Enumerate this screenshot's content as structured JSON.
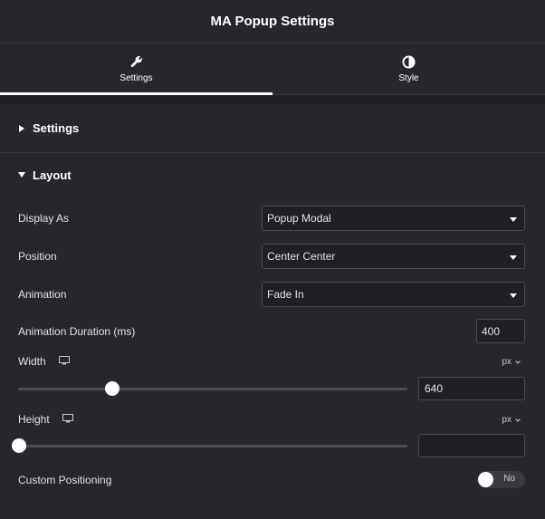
{
  "header": {
    "title": "MA Popup Settings"
  },
  "tabs": [
    {
      "label": "Settings",
      "icon": "wrench-icon",
      "active": true
    },
    {
      "label": "Style",
      "icon": "half-circle-icon",
      "active": false
    }
  ],
  "sections": {
    "settings": {
      "label": "Settings",
      "expanded": false
    },
    "layout": {
      "label": "Layout",
      "expanded": true
    }
  },
  "layout": {
    "display_as": {
      "label": "Display As",
      "value": "Popup Modal"
    },
    "position": {
      "label": "Position",
      "value": "Center Center"
    },
    "animation": {
      "label": "Animation",
      "value": "Fade In"
    },
    "animation_duration": {
      "label": "Animation Duration (ms)",
      "value": "400"
    },
    "width": {
      "label": "Width",
      "unit": "px",
      "value": "640",
      "slider_fraction": 0.25
    },
    "height": {
      "label": "Height",
      "unit": "px",
      "value": "",
      "slider_fraction": 0.0
    },
    "custom_positioning": {
      "label": "Custom Positioning",
      "toggle_text": "No",
      "enabled": false
    }
  },
  "colors": {
    "background": "#26272b",
    "input_background": "#1f2024",
    "border": "#4a4b50",
    "text": "#e1e2e5",
    "accent": "#ffffff"
  }
}
